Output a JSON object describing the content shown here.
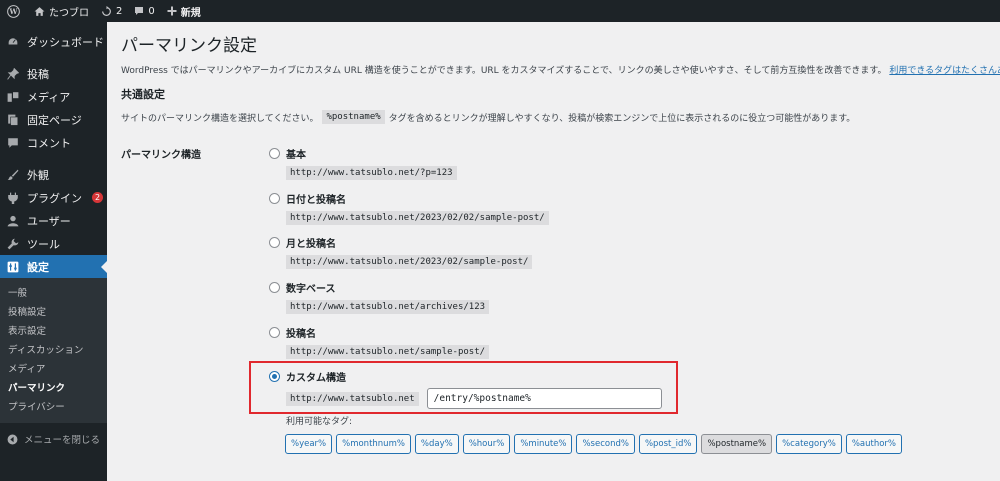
{
  "adminbar": {
    "site_name": "たつブロ",
    "updates_count": "2",
    "comments_count": "0",
    "new_label": "新規"
  },
  "sidebar": {
    "items": [
      {
        "label": "ダッシュボード",
        "icon": "dashboard-icon"
      },
      {
        "label": "投稿",
        "icon": "pin-icon"
      },
      {
        "label": "メディア",
        "icon": "media-icon"
      },
      {
        "label": "固定ページ",
        "icon": "page-icon"
      },
      {
        "label": "コメント",
        "icon": "comment-icon"
      },
      {
        "label": "外観",
        "icon": "brush-icon"
      },
      {
        "label": "プラグイン",
        "icon": "plugin-icon",
        "badge": "2"
      },
      {
        "label": "ユーザー",
        "icon": "user-icon"
      },
      {
        "label": "ツール",
        "icon": "wrench-icon"
      },
      {
        "label": "設定",
        "icon": "settings-icon"
      }
    ],
    "submenu": [
      "一般",
      "投稿設定",
      "表示設定",
      "ディスカッション",
      "メディア",
      "パーマリンク",
      "プライバシー"
    ],
    "collapse_label": "メニューを閉じる"
  },
  "main": {
    "title": "パーマリンク設定",
    "intro_text": "WordPress ではパーマリンクやアーカイブにカスタム URL 構造を使うことができます。URL をカスタマイズすることで、リンクの美しさや使いやすさ、そして前方互換性を改善できます。",
    "intro_link": "利用できるタグはたくさんあります",
    "section_title": "共通設定",
    "section_desc_before": "サイトのパーマリンク構造を選択してください。",
    "section_desc_code": "%postname%",
    "section_desc_after": "タグを含めるとリンクが理解しやすくなり、投稿が検索エンジンで上位に表示されるのに役立つ可能性があります。",
    "field_label": "パーマリンク構造",
    "options": [
      {
        "label": "基本",
        "example": "http://www.tatsublo.net/?p=123"
      },
      {
        "label": "日付と投稿名",
        "example": "http://www.tatsublo.net/2023/02/02/sample-post/"
      },
      {
        "label": "月と投稿名",
        "example": "http://www.tatsublo.net/2023/02/sample-post/"
      },
      {
        "label": "数字ベース",
        "example": "http://www.tatsublo.net/archives/123"
      },
      {
        "label": "投稿名",
        "example": "http://www.tatsublo.net/sample-post/"
      }
    ],
    "custom": {
      "label": "カスタム構造",
      "base_url": "http://www.tatsublo.net",
      "value": "/entry/%postname%"
    },
    "tags_label": "利用可能なタグ:",
    "tags": [
      "%year%",
      "%monthnum%",
      "%day%",
      "%hour%",
      "%minute%",
      "%second%",
      "%post_id%",
      "%postname%",
      "%category%",
      "%author%"
    ],
    "active_tag": "%postname%"
  }
}
